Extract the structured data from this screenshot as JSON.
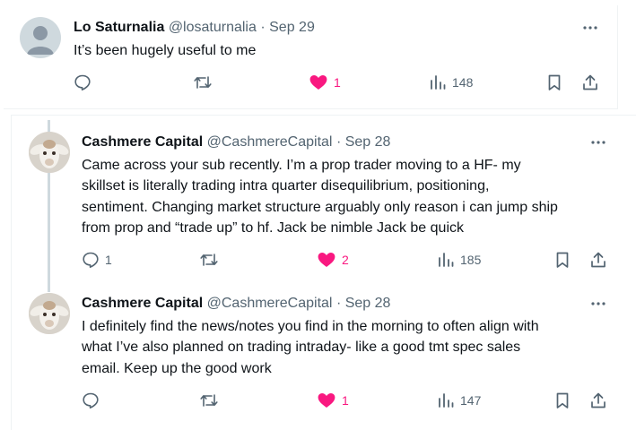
{
  "tweets": [
    {
      "name": "Lo Saturnalia",
      "handle": "@losaturnalia",
      "sep": "·",
      "date": "Sep 29",
      "lines": [
        "It’s been hugely useful to me"
      ],
      "replies": "",
      "retweets": "",
      "likes": "1",
      "views": "148"
    },
    {
      "name": "Cashmere Capital",
      "handle": "@CashmereCapital",
      "sep": "·",
      "date": "Sep 28",
      "lines": [
        "Came across your sub recently. I’m a prop trader moving to a HF- my",
        "skillset is literally trading intra quarter disequilibrium, positioning,",
        "sentiment. Changing market structure arguably only reason i can jump ship",
        "from prop and “trade up” to hf. Jack be nimble Jack be quick"
      ],
      "replies": "1",
      "retweets": "",
      "likes": "2",
      "views": "185"
    },
    {
      "name": "Cashmere Capital",
      "handle": "@CashmereCapital",
      "sep": "·",
      "date": "Sep 28",
      "lines": [
        "I definitely find the news/notes you find in the morning to often align with",
        "what I’ve also planned on trading intraday- like a good tmt spec sales",
        "email. Keep up the good work"
      ],
      "replies": "",
      "retweets": "",
      "likes": "1",
      "views": "147"
    }
  ],
  "colors": {
    "like": "#f91880",
    "muted": "#536471",
    "text": "#0f1419",
    "border": "#eff3f4",
    "thread": "#cfd9de"
  },
  "icons": [
    "more-icon",
    "reply-icon",
    "retweet-icon",
    "heart-icon",
    "views-icon",
    "bookmark-icon",
    "share-icon"
  ]
}
